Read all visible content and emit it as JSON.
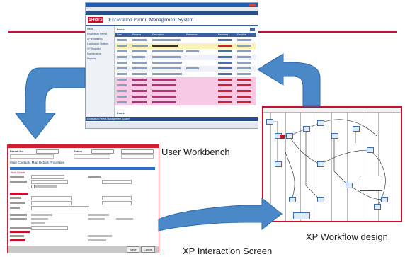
{
  "captions": {
    "workbench": "User Workbench",
    "workflow": "XP Workflow design",
    "interaction": "XP Interaction Screen"
  },
  "workbench_screen": {
    "app_title": "Excavation Permit Management System",
    "logo_text": "SPIRITS",
    "section_label": "Inbox",
    "sidebar_header": "Inbox",
    "sidebar_items": [
      "Excavation Permit",
      "XP Interaction",
      "Landowner Notices",
      "XP Request",
      "Maintenance",
      "Reports"
    ],
    "table_headers": [
      "Date",
      "Process",
      "Description",
      "Reference",
      "Received",
      "Deadline"
    ],
    "row_count": 12,
    "footer_label": "Inbox",
    "status_text": "Excavation Permit Management System"
  },
  "interaction_screen": {
    "title": "Permit No",
    "status_label": "Status",
    "tabs_text": "Main   Contacts   Map Details   Properties",
    "section_label": "Work Details",
    "buttons": [
      "Save",
      "Cancel"
    ]
  },
  "workflow_screen": {
    "lane_count": 9
  },
  "colors": {
    "accent_red": "#c8102e",
    "arrow_fill": "#4a88c8",
    "arrow_stroke": "#2d6aa8",
    "window_blue": "#1d5fb7",
    "highlight_pink": "#f7c9e4",
    "highlight_yellow": "#fbf2b8",
    "flow_blue": "#3b6db0"
  }
}
